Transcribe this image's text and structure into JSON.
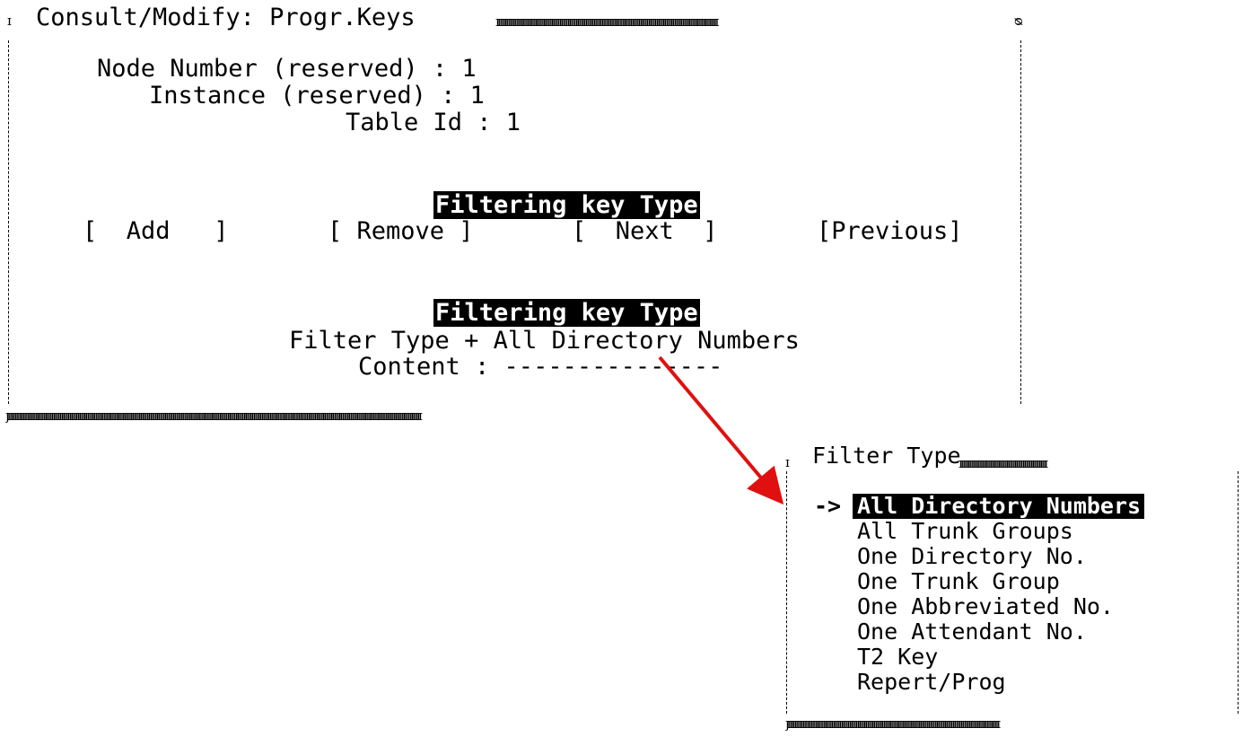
{
  "window": {
    "title": "Consult/Modify: Progr.Keys"
  },
  "fields": {
    "node_label": "Node Number (reserved) : 1",
    "instance_label": "Instance (reserved) : 1",
    "table_label": "Table Id : 1"
  },
  "section_header": "Filtering key Type",
  "buttons": {
    "add": "[  Add   ]",
    "remove": "[ Remove ]",
    "next": "[  Next  ]",
    "previous": "[Previous]"
  },
  "filter": {
    "type_line": "Filter Type + All Directory Numbers",
    "content_line": "Content : ---------------"
  },
  "popup": {
    "title": "Filter Type",
    "pointer": "->",
    "selected_index": 0,
    "options": [
      "All Directory Numbers",
      "All Trunk Groups",
      "One Directory No.",
      "One Trunk Group",
      "One Abbreviated No.",
      "One Attendant No.",
      "T2 Key",
      "Repert/Prog"
    ]
  },
  "colors": {
    "arrow": "#e01010",
    "highlight_bg": "#000000",
    "highlight_fg": "#ffffff"
  }
}
